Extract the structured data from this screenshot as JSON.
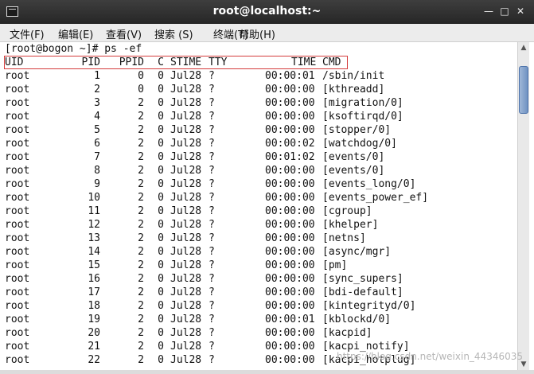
{
  "window": {
    "title": "root@localhost:~"
  },
  "menu": [
    {
      "label": "文件(F)"
    },
    {
      "label": "编辑(E)"
    },
    {
      "label": "查看(V)"
    },
    {
      "label": "搜索 (S)"
    },
    {
      "label": "终端(T)"
    },
    {
      "label": "帮助(H)"
    }
  ],
  "terminal": {
    "prompt": "[root@bogon ~]# ps -ef",
    "header": {
      "uid": "UID",
      "pid": "PID",
      "ppid": "PPID",
      "c": "C",
      "stime": "STIME",
      "tty": "TTY",
      "time": "TIME",
      "cmd": "CMD"
    },
    "rows": [
      {
        "uid": "root",
        "pid": "1",
        "ppid": "0",
        "c": "0",
        "stime": "Jul28",
        "tty": "?",
        "time": "00:00:01",
        "cmd": "/sbin/init"
      },
      {
        "uid": "root",
        "pid": "2",
        "ppid": "0",
        "c": "0",
        "stime": "Jul28",
        "tty": "?",
        "time": "00:00:00",
        "cmd": "[kthreadd]"
      },
      {
        "uid": "root",
        "pid": "3",
        "ppid": "2",
        "c": "0",
        "stime": "Jul28",
        "tty": "?",
        "time": "00:00:00",
        "cmd": "[migration/0]"
      },
      {
        "uid": "root",
        "pid": "4",
        "ppid": "2",
        "c": "0",
        "stime": "Jul28",
        "tty": "?",
        "time": "00:00:00",
        "cmd": "[ksoftirqd/0]"
      },
      {
        "uid": "root",
        "pid": "5",
        "ppid": "2",
        "c": "0",
        "stime": "Jul28",
        "tty": "?",
        "time": "00:00:00",
        "cmd": "[stopper/0]"
      },
      {
        "uid": "root",
        "pid": "6",
        "ppid": "2",
        "c": "0",
        "stime": "Jul28",
        "tty": "?",
        "time": "00:00:02",
        "cmd": "[watchdog/0]"
      },
      {
        "uid": "root",
        "pid": "7",
        "ppid": "2",
        "c": "0",
        "stime": "Jul28",
        "tty": "?",
        "time": "00:01:02",
        "cmd": "[events/0]"
      },
      {
        "uid": "root",
        "pid": "8",
        "ppid": "2",
        "c": "0",
        "stime": "Jul28",
        "tty": "?",
        "time": "00:00:00",
        "cmd": "[events/0]"
      },
      {
        "uid": "root",
        "pid": "9",
        "ppid": "2",
        "c": "0",
        "stime": "Jul28",
        "tty": "?",
        "time": "00:00:00",
        "cmd": "[events_long/0]"
      },
      {
        "uid": "root",
        "pid": "10",
        "ppid": "2",
        "c": "0",
        "stime": "Jul28",
        "tty": "?",
        "time": "00:00:00",
        "cmd": "[events_power_ef]"
      },
      {
        "uid": "root",
        "pid": "11",
        "ppid": "2",
        "c": "0",
        "stime": "Jul28",
        "tty": "?",
        "time": "00:00:00",
        "cmd": "[cgroup]"
      },
      {
        "uid": "root",
        "pid": "12",
        "ppid": "2",
        "c": "0",
        "stime": "Jul28",
        "tty": "?",
        "time": "00:00:00",
        "cmd": "[khelper]"
      },
      {
        "uid": "root",
        "pid": "13",
        "ppid": "2",
        "c": "0",
        "stime": "Jul28",
        "tty": "?",
        "time": "00:00:00",
        "cmd": "[netns]"
      },
      {
        "uid": "root",
        "pid": "14",
        "ppid": "2",
        "c": "0",
        "stime": "Jul28",
        "tty": "?",
        "time": "00:00:00",
        "cmd": "[async/mgr]"
      },
      {
        "uid": "root",
        "pid": "15",
        "ppid": "2",
        "c": "0",
        "stime": "Jul28",
        "tty": "?",
        "time": "00:00:00",
        "cmd": "[pm]"
      },
      {
        "uid": "root",
        "pid": "16",
        "ppid": "2",
        "c": "0",
        "stime": "Jul28",
        "tty": "?",
        "time": "00:00:00",
        "cmd": "[sync_supers]"
      },
      {
        "uid": "root",
        "pid": "17",
        "ppid": "2",
        "c": "0",
        "stime": "Jul28",
        "tty": "?",
        "time": "00:00:00",
        "cmd": "[bdi-default]"
      },
      {
        "uid": "root",
        "pid": "18",
        "ppid": "2",
        "c": "0",
        "stime": "Jul28",
        "tty": "?",
        "time": "00:00:00",
        "cmd": "[kintegrityd/0]"
      },
      {
        "uid": "root",
        "pid": "19",
        "ppid": "2",
        "c": "0",
        "stime": "Jul28",
        "tty": "?",
        "time": "00:00:01",
        "cmd": "[kblockd/0]"
      },
      {
        "uid": "root",
        "pid": "20",
        "ppid": "2",
        "c": "0",
        "stime": "Jul28",
        "tty": "?",
        "time": "00:00:00",
        "cmd": "[kacpid]"
      },
      {
        "uid": "root",
        "pid": "21",
        "ppid": "2",
        "c": "0",
        "stime": "Jul28",
        "tty": "?",
        "time": "00:00:00",
        "cmd": "[kacpi_notify]"
      },
      {
        "uid": "root",
        "pid": "22",
        "ppid": "2",
        "c": "0",
        "stime": "Jul28",
        "tty": "?",
        "time": "00:00:00",
        "cmd": "[kacpi_hotplug]"
      }
    ]
  },
  "watermark": "https://blog.csdn.net/weixin_44346035",
  "colors": {
    "titlebar": "#2e2e2e",
    "highlight_box": "#d43b3b",
    "scroll_thumb": "#6f92c2"
  }
}
